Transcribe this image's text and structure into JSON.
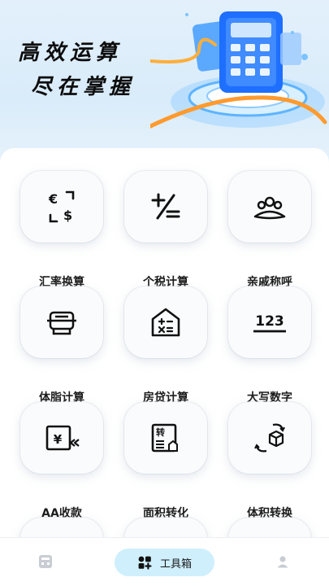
{
  "banner": {
    "line1": "高效运算",
    "line2": "尽在掌握"
  },
  "tools": [
    {
      "label": "汇率换算",
      "icon": "currency-exchange-icon"
    },
    {
      "label": "个税计算",
      "icon": "tax-plus-minus-icon"
    },
    {
      "label": "亲戚称呼",
      "icon": "relatives-icon"
    },
    {
      "label": "体脂计算",
      "icon": "body-fat-scale-icon"
    },
    {
      "label": "房贷计算",
      "icon": "house-loan-icon"
    },
    {
      "label": "大写数字",
      "icon": "number-123-icon"
    },
    {
      "label": "AA收款",
      "icon": "aa-payment-icon"
    },
    {
      "label": "面积转化",
      "icon": "area-convert-icon"
    },
    {
      "label": "体积转换",
      "icon": "volume-convert-icon"
    }
  ],
  "icon_text": {
    "currency_a": "€",
    "currency_b": "$",
    "number": "123",
    "yen": "¥",
    "zhuan": "转"
  },
  "tabbar": {
    "active_label": "工具箱"
  },
  "colors": {
    "accent": "#cfeffd",
    "banner_bg": "#dcedfa",
    "text": "#1c1c1c"
  }
}
